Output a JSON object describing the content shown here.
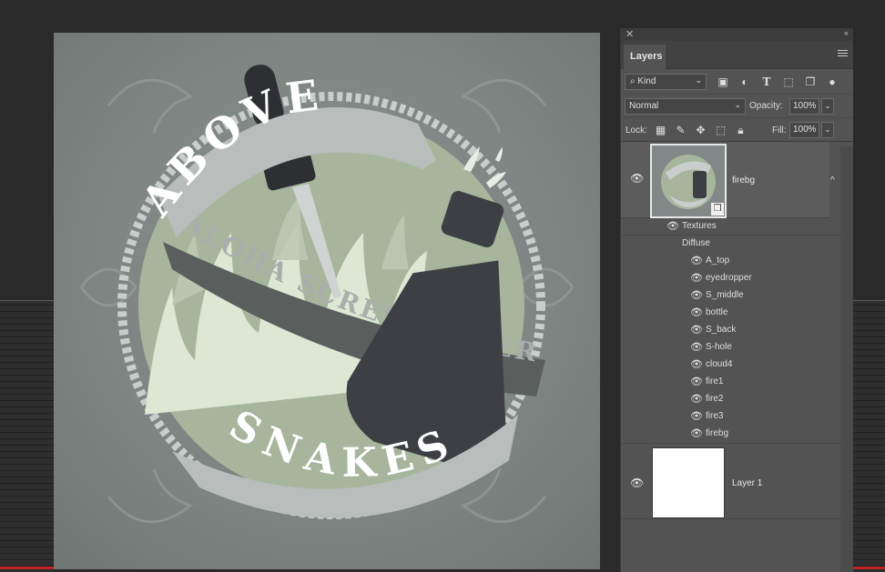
{
  "panel": {
    "title_tab": "Layers",
    "kind_filter": "Kind",
    "blend_mode": "Normal",
    "opacity_label": "Opacity:",
    "opacity_value": "100%",
    "lock_label": "Lock:",
    "fill_label": "Fill:",
    "fill_value": "100%"
  },
  "layers": [
    {
      "name": "firebg",
      "textures_label": "Textures",
      "diffuse_label": "Diffuse",
      "sublayers": [
        "A_top",
        "eyedropper",
        "S_middle",
        "bottle",
        "S_back",
        "S-hole",
        "cloud4",
        "fire1",
        "fire2",
        "fire3",
        "firebg"
      ]
    },
    {
      "name": "Layer 1"
    }
  ],
  "artwork": {
    "top_text": "ABOVE",
    "middle_text": "ALOHA SCREWDRIVER",
    "bottom_text": "SNAKES"
  },
  "colors": {
    "canvas_bg": "#7d8482",
    "green_circle": "#a6b59c",
    "flame_light": "#dde7d4",
    "banner_light": "#b9bebc",
    "banner_dark": "#5a5f5e",
    "bottle": "#3d3f44",
    "panel_bg": "#535353"
  }
}
